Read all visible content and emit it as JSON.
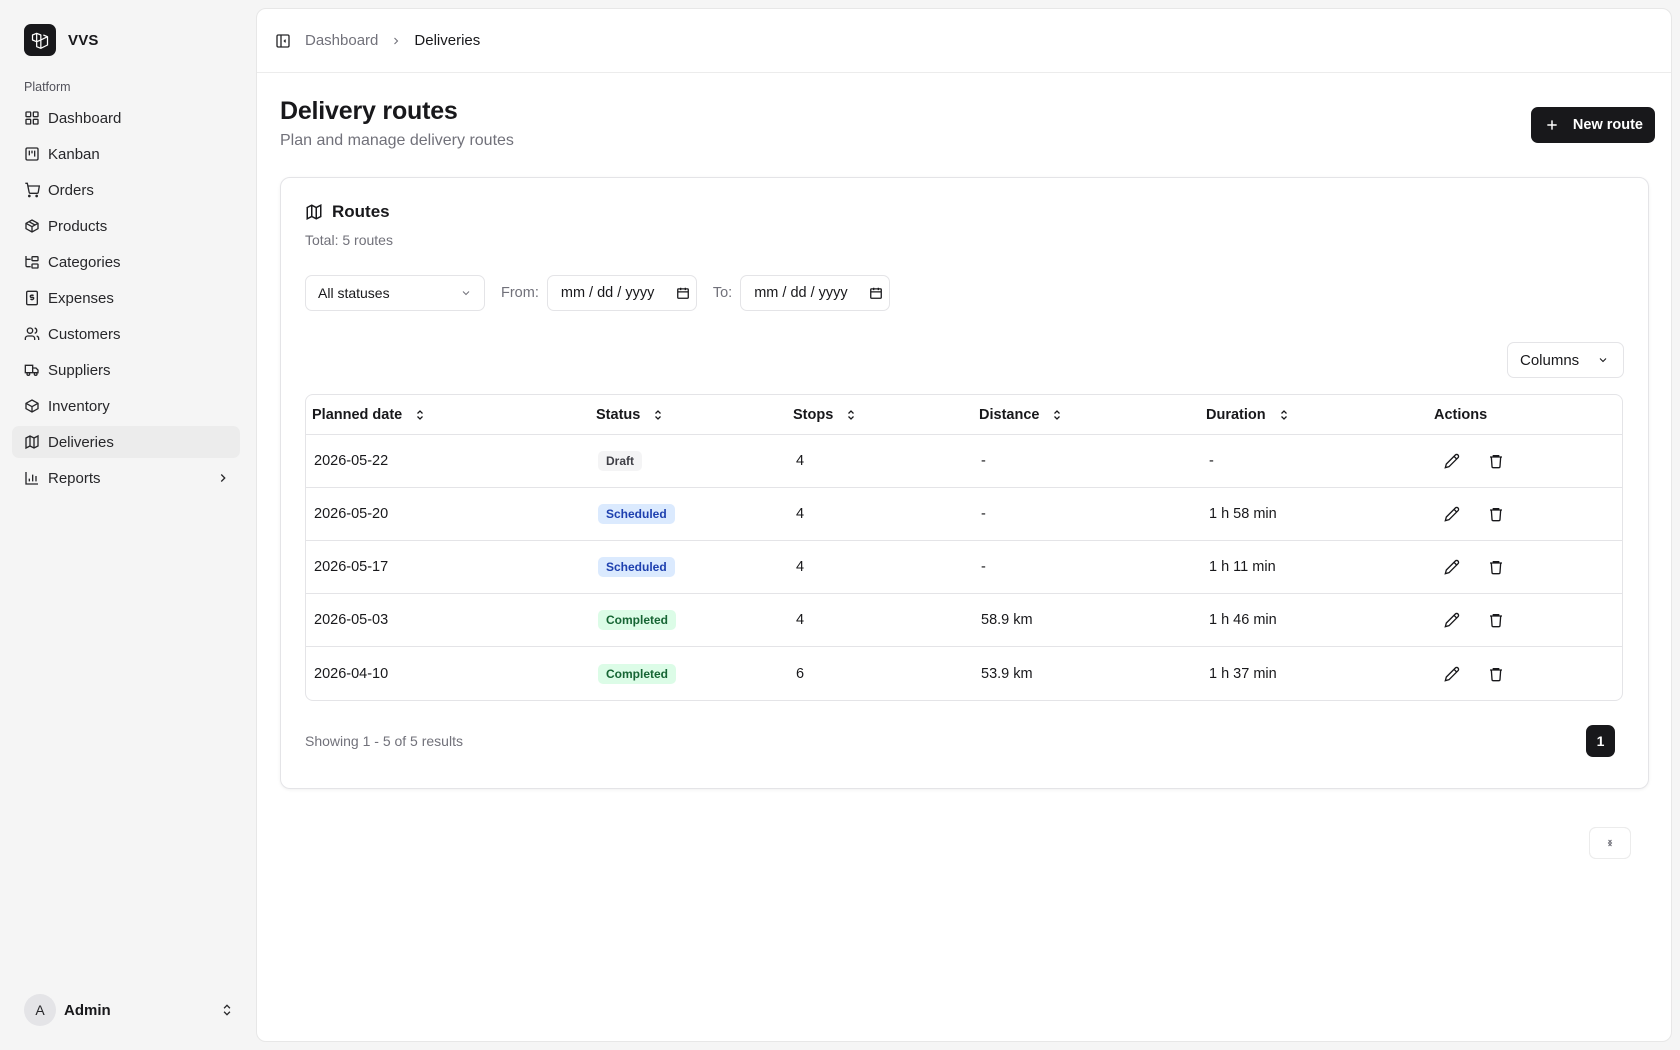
{
  "app": {
    "name": "VVS"
  },
  "sidebar": {
    "group_label": "Platform",
    "items": [
      {
        "label": "Dashboard",
        "icon": "layout-grid-icon"
      },
      {
        "label": "Kanban",
        "icon": "kanban-icon"
      },
      {
        "label": "Orders",
        "icon": "shopping-cart-icon"
      },
      {
        "label": "Products",
        "icon": "package-icon"
      },
      {
        "label": "Categories",
        "icon": "folder-tree-icon"
      },
      {
        "label": "Expenses",
        "icon": "receipt-icon"
      },
      {
        "label": "Customers",
        "icon": "users-icon"
      },
      {
        "label": "Suppliers",
        "icon": "truck-icon"
      },
      {
        "label": "Inventory",
        "icon": "box-icon"
      },
      {
        "label": "Deliveries",
        "icon": "map-icon",
        "active": true
      },
      {
        "label": "Reports",
        "icon": "bar-chart-icon",
        "has_submenu": true
      }
    ],
    "user": {
      "initial": "A",
      "name": "Admin"
    }
  },
  "breadcrumb": {
    "parent": "Dashboard",
    "current": "Deliveries"
  },
  "page": {
    "title": "Delivery routes",
    "subtitle": "Plan and manage delivery routes",
    "new_button": "New route"
  },
  "card": {
    "title": "Routes",
    "total": "Total: 5 routes",
    "filters": {
      "status_value": "All statuses",
      "from_label": "From:",
      "from_value": "mm / dd / yyyy",
      "to_label": "To:",
      "to_value": "mm / dd / yyyy"
    },
    "columns_button": "Columns",
    "table": {
      "headers": [
        "Planned date",
        "Status",
        "Stops",
        "Distance",
        "Duration",
        "Actions"
      ],
      "rows": [
        {
          "date": "2026-05-22",
          "status": "Draft",
          "stops": "4",
          "distance": "-",
          "duration": "-"
        },
        {
          "date": "2026-05-20",
          "status": "Scheduled",
          "stops": "4",
          "distance": "-",
          "duration": "1 h 58 min"
        },
        {
          "date": "2026-05-17",
          "status": "Scheduled",
          "stops": "4",
          "distance": "-",
          "duration": "1 h 11 min"
        },
        {
          "date": "2026-05-03",
          "status": "Completed",
          "stops": "4",
          "distance": "58.9 km",
          "duration": "1 h 46 min"
        },
        {
          "date": "2026-04-10",
          "status": "Completed",
          "stops": "6",
          "distance": "53.9 km",
          "duration": "1 h 37 min"
        }
      ]
    },
    "results_text": "Showing 1 - 5 of 5 results",
    "pagination": {
      "current_page": "1"
    }
  },
  "colors": {
    "primary": "#18181b",
    "scheduled_badge": "#dbeafe",
    "completed_badge": "#dcfce7"
  }
}
